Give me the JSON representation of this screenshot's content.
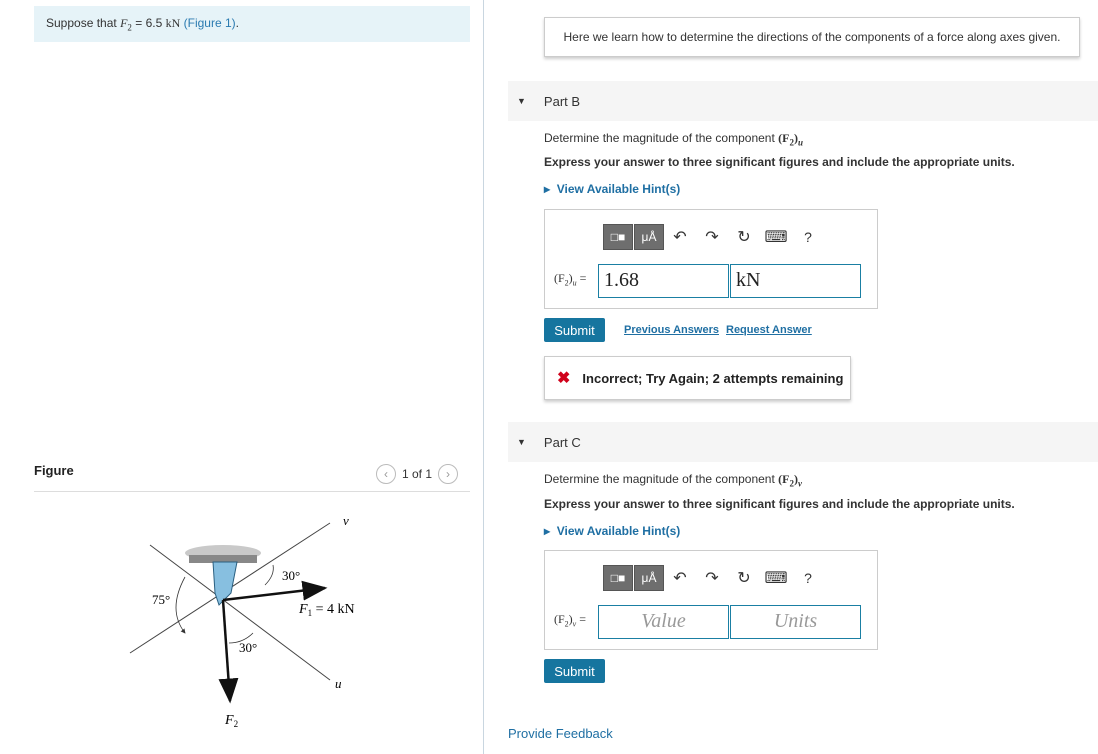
{
  "intro": {
    "prefix": "Suppose that ",
    "var": "F",
    "sub": "2",
    "eq": " = 6.5 ",
    "unit": "kN",
    "link": "(Figure 1)",
    "suffix": "."
  },
  "figure": {
    "label": "Figure",
    "pager": "1 of 1",
    "labels": {
      "v": "v",
      "u": "u",
      "angle_30_top": "30°",
      "angle_75": "75°",
      "angle_30_bottom": "30°",
      "f1": "F",
      "f1_sub": "1",
      "f1_eq": " = 4 kN",
      "f2": "F",
      "f2_sub": "2"
    }
  },
  "banner": "Here we learn how to determine the directions of the components of a force along axes given.",
  "parts": [
    {
      "title": "Part B",
      "question_prefix": "Determine the magnitude of the component ",
      "question_math": "(F",
      "question_sub": "2",
      "question_close": ")",
      "question_axis": "u",
      "instruction": "Express your answer to three significant figures and include the appropriate units.",
      "hint": "View Available Hint(s)",
      "answer_label": "(F",
      "answer_sub": "2",
      "answer_axis": ")",
      "answer_axis_var": "u",
      "answer_eq": " =",
      "value": "1.68",
      "units": "kN",
      "submit": "Submit",
      "prev_answers": "Previous Answers",
      "request_answer": "Request Answer",
      "feedback": "Incorrect; Try Again; 2 attempts remaining"
    },
    {
      "title": "Part C",
      "question_prefix": "Determine the magnitude of the component ",
      "question_math": "(F",
      "question_sub": "2",
      "question_close": ")",
      "question_axis": "v",
      "instruction": "Express your answer to three significant figures and include the appropriate units.",
      "hint": "View Available Hint(s)",
      "answer_label": "(F",
      "answer_sub": "2",
      "answer_axis": ")",
      "answer_axis_var": "v",
      "answer_eq": " =",
      "value_placeholder": "Value",
      "units_placeholder": "Units",
      "submit": "Submit"
    }
  ],
  "toolbar": {
    "mu_a": "μÅ",
    "help": "?"
  },
  "provide_feedback": "Provide Feedback"
}
